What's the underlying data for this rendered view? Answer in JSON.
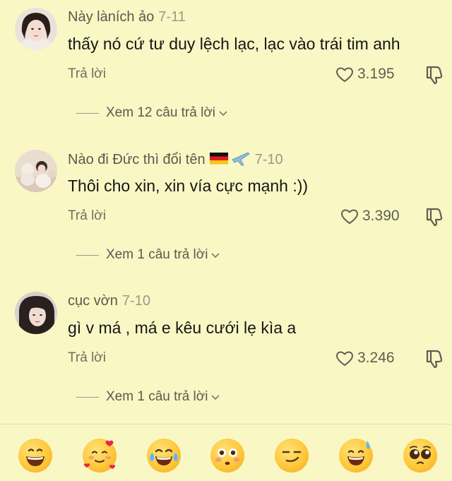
{
  "comments": [
    {
      "username": "Này làních ảo",
      "date": "7-11",
      "text": "thấy nó cứ tư duy lệch lạc, lạc vào trái tim anh",
      "reply_label": "Trả lời",
      "likes": "3.195",
      "view_replies": "Xem 12 câu trả lời"
    },
    {
      "username": "Nào đi Đức thì đổi tên",
      "date": "7-10",
      "text": "Thôi cho xin, xin vía cực mạnh :))",
      "reply_label": "Trả lời",
      "likes": "3.390",
      "view_replies": "Xem 1 câu trả lời"
    },
    {
      "username": "cục vờn",
      "date": "7-10",
      "text": "gì v má , má e kêu cưới lẹ kìa a",
      "reply_label": "Trả lời",
      "likes": "3.246",
      "view_replies": "Xem 1 câu trả lời"
    }
  ],
  "emoji_bar": [
    "grinning",
    "smiling-hearts",
    "tears-of-joy",
    "flushed",
    "smirk",
    "sweat-smile",
    "pleading"
  ],
  "colors": {
    "background": "#f9f7c4",
    "secondary_text": "#6f6f62"
  }
}
